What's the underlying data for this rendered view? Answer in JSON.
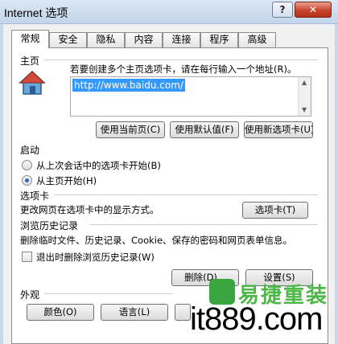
{
  "window": {
    "title": "Internet 选项",
    "help_label": "?",
    "close_label": "✕"
  },
  "tabs": [
    {
      "label": "常规",
      "active": true
    },
    {
      "label": "安全"
    },
    {
      "label": "隐私"
    },
    {
      "label": "内容"
    },
    {
      "label": "连接"
    },
    {
      "label": "程序"
    },
    {
      "label": "高级"
    }
  ],
  "home": {
    "group_title": "主页",
    "instruction": "若要创建多个主页选项卡，请在每行输入一个地址(R)。",
    "url_value": "http://www.baidu.com/",
    "buttons": [
      "使用当前页(C)",
      "使用默认值(F)",
      "使用新选项卡(U)"
    ]
  },
  "startup": {
    "group_title": "启动",
    "options": [
      {
        "label": "从上次会话中的选项卡开始(B)",
        "checked": false
      },
      {
        "label": "从主页开始(H)",
        "checked": true
      }
    ]
  },
  "tabs_section": {
    "group_title": "选项卡",
    "description": "更改网页在选项卡中的显示方式。",
    "button": "选项卡(T)"
  },
  "history": {
    "group_title": "浏览历史记录",
    "description": "删除临时文件、历史记录、Cookie、保存的密码和网页表单信息。",
    "checkbox_label": "退出时删除浏览历史记录(W)",
    "checkbox_checked": false,
    "delete_button": "删除(D)...",
    "settings_button": "设置(S)"
  },
  "appearance": {
    "group_title": "外观",
    "buttons": [
      "颜色(O)",
      "语言(L)"
    ]
  },
  "watermark": {
    "brand": "it889.com",
    "brand_cn": "易捷重装"
  },
  "colors": {
    "selection": "#3399ff",
    "radio_dot": "#2a6bb8",
    "watermark_green": "#4db848"
  }
}
